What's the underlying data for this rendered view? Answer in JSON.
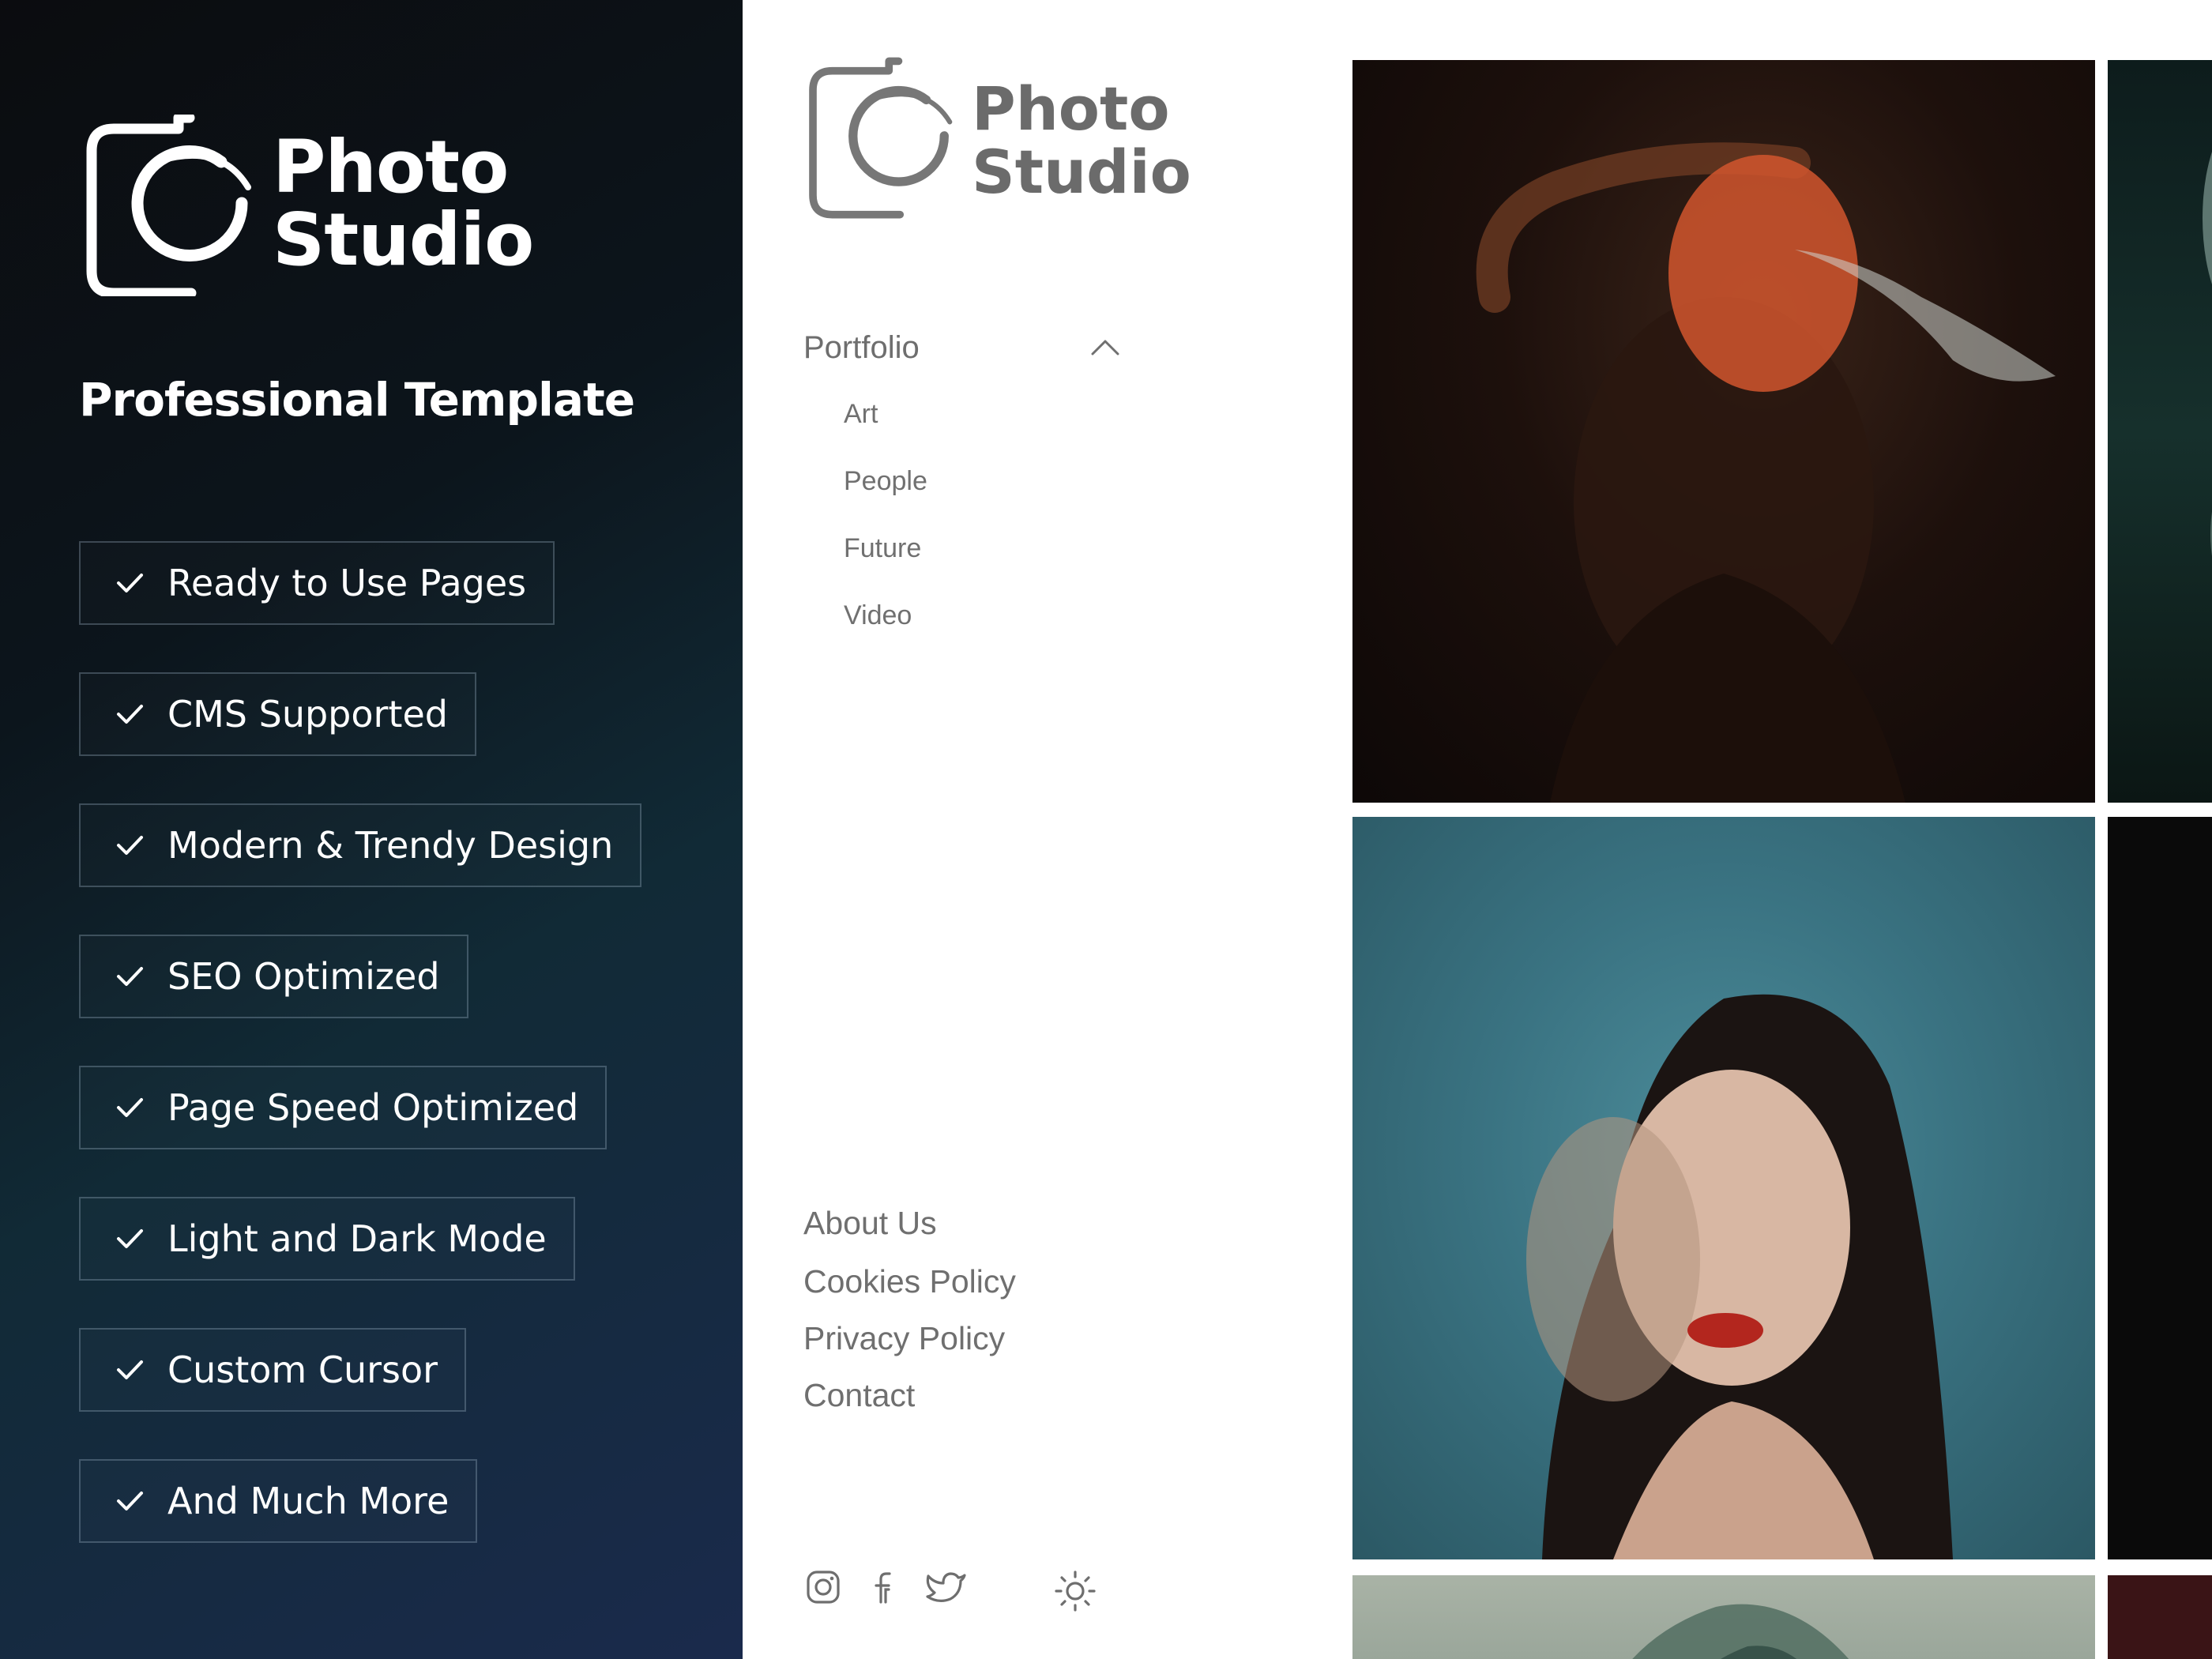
{
  "promo": {
    "brand_line1": "Photo",
    "brand_line2": "Studio",
    "tagline": "Professional Template",
    "features": [
      "Ready to Use Pages",
      "CMS Supported",
      "Modern & Trendy Design",
      "SEO Optimized",
      "Page Speed Optimized",
      "Light and Dark Mode",
      "Custom Cursor",
      "And Much More"
    ]
  },
  "site": {
    "brand_line1": "Photo",
    "brand_line2": "Studio",
    "nav": {
      "section_label": "Portfolio",
      "expanded": true,
      "items": [
        "Art",
        "People",
        "Future",
        "Video"
      ]
    },
    "footer_links": [
      "About Us",
      "Cookies Policy",
      "Privacy Policy",
      "Contact"
    ],
    "social_icons": [
      "instagram-icon",
      "facebook-icon",
      "twitter-icon"
    ],
    "theme_toggle_icon": "sun-icon"
  },
  "colors": {
    "promo_bg_start": "#0b0c0f",
    "promo_bg_end": "#1a2a4c",
    "site_text": "#6e6e6e",
    "site_bg": "#ffffff"
  }
}
